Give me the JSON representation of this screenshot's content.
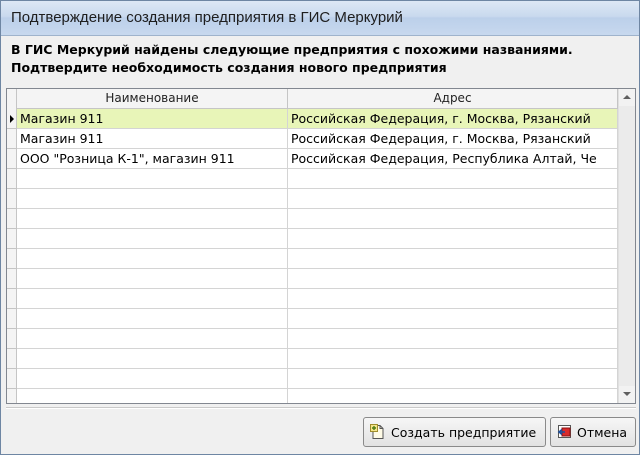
{
  "window": {
    "title": "Подтверждение создания предприятия в ГИС Меркурий"
  },
  "message": {
    "line1": "В ГИС Меркурий найдены следующие предприятия с похожими названиями.",
    "line2": "Подтвердите необходимость создания нового предприятия"
  },
  "table": {
    "columns": [
      "Наименование",
      "Адрес"
    ],
    "rows": [
      {
        "name": "Магазин 911",
        "address": "Российская Федерация, г. Москва, Рязанский",
        "selected": true
      },
      {
        "name": "Магазин 911",
        "address": "Российская Федерация, г. Москва, Рязанский",
        "selected": false
      },
      {
        "name": "ООО \"Розница К-1\", магазин 911",
        "address": "Российская Федерация, Республика Алтай, Че",
        "selected": false
      }
    ],
    "selected_color": "#e8f5b8"
  },
  "buttons": {
    "create_label": "Создать предприятие",
    "create_icon": "new-document-icon",
    "cancel_label": "Отмена",
    "cancel_icon": "cancel-icon"
  }
}
